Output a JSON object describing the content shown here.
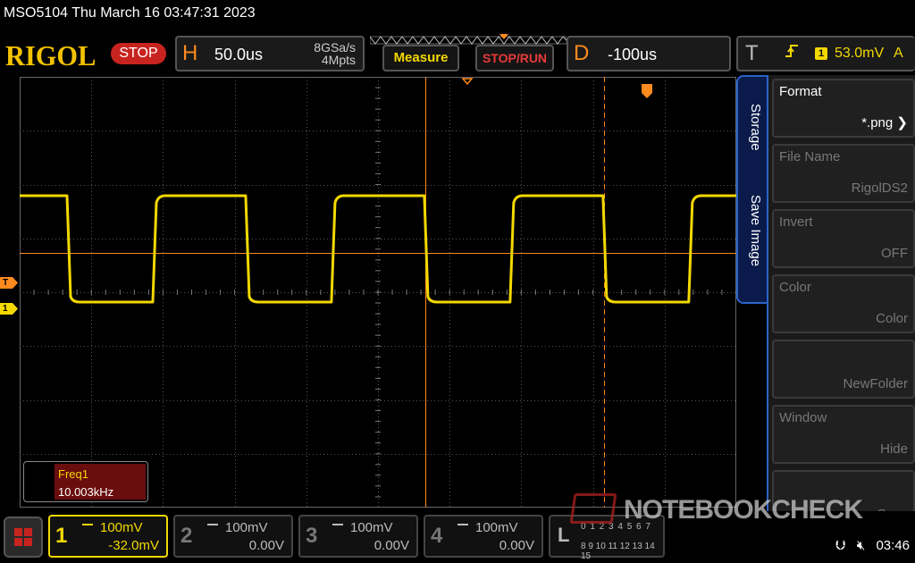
{
  "title_bar": {
    "text": "MSO5104  Thu March 16 03:47:31 2023"
  },
  "header": {
    "logo": "RIGOL",
    "run_state": "STOP",
    "horizontal": {
      "letter": "H",
      "timebase": "50.0us",
      "sample_rate": "8GSa/s",
      "memory_depth": "4Mpts"
    },
    "measure_label": "Measure",
    "stoprun_label": "STOP/RUN",
    "delay": {
      "letter": "D",
      "value": "-100us"
    },
    "trigger": {
      "letter": "T",
      "edge_icon": "rising-edge-icon",
      "source": "1",
      "level": "53.0mV",
      "mode": "A"
    }
  },
  "waveform": {
    "frequency_khz": 10.003,
    "duty_cycle": 0.5,
    "high_mv": 80,
    "low_mv": -90,
    "color": "#f3d800"
  },
  "markers": {
    "trigger": "T",
    "channel": "1"
  },
  "measurement": {
    "label": "Freq1",
    "value": "10.003kHz"
  },
  "side_panel": {
    "tabs": [
      "Storage",
      "Save Image"
    ],
    "items": [
      {
        "label": "Format",
        "value": "*.png",
        "enabled": true
      },
      {
        "label": "File Name",
        "value": "RigolDS2",
        "enabled": false
      },
      {
        "label": "Invert",
        "value": "OFF",
        "enabled": false
      },
      {
        "label": "Color",
        "value": "Color",
        "enabled": false
      },
      {
        "label": "",
        "value": "NewFolder",
        "enabled": false
      },
      {
        "label": "Window",
        "value": "Hide",
        "enabled": false
      },
      {
        "label": "",
        "value": "Save",
        "enabled": false
      }
    ]
  },
  "channels": [
    {
      "num": "1",
      "scale": "100mV",
      "offset": "-32.0mV",
      "active": true
    },
    {
      "num": "2",
      "scale": "100mV",
      "offset": "0.00V",
      "active": false
    },
    {
      "num": "3",
      "scale": "100mV",
      "offset": "0.00V",
      "active": false
    },
    {
      "num": "4",
      "scale": "100mV",
      "offset": "0.00V",
      "active": false
    }
  ],
  "logic": {
    "letter": "L",
    "row1": "0 1 2 3 4 5 6 7",
    "row2": "8 9 10 11 12 13 14 15"
  },
  "watermark": "NOTEBOOKCHECK",
  "status": {
    "usb_icon": "usb-icon",
    "mute_icon": "speaker-mute-icon",
    "time": "03:46"
  },
  "colors": {
    "accent": "#ff8a1e",
    "channel1": "#f3d800",
    "stop": "#c8241f",
    "menu_border": "#2a63c8"
  }
}
